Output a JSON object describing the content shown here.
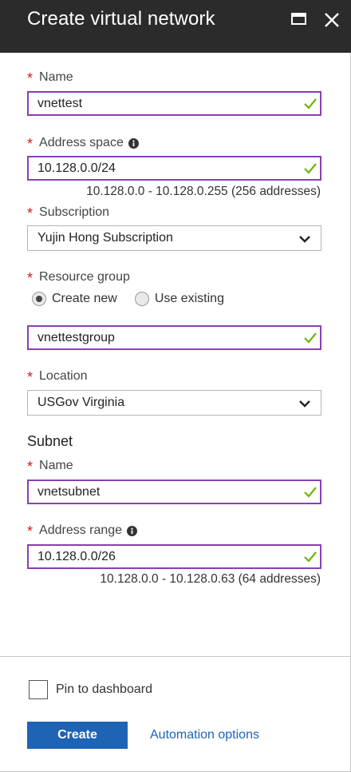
{
  "header": {
    "title": "Create virtual network"
  },
  "fields": {
    "name": {
      "label": "Name",
      "value": "vnettest"
    },
    "address_space": {
      "label": "Address space",
      "value": "10.128.0.0/24",
      "hint": "10.128.0.0 - 10.128.0.255 (256 addresses)"
    },
    "subscription": {
      "label": "Subscription",
      "value": "Yujin Hong Subscription"
    },
    "resource_group": {
      "label": "Resource group",
      "options": [
        "Create new",
        "Use existing"
      ],
      "selected": "Create new",
      "value": "vnettestgroup"
    },
    "location": {
      "label": "Location",
      "value": "USGov Virginia"
    }
  },
  "subnet": {
    "title": "Subnet",
    "name": {
      "label": "Name",
      "value": "vnetsubnet"
    },
    "address_range": {
      "label": "Address range",
      "value": "10.128.0.0/26",
      "hint": "10.128.0.0 - 10.128.0.63 (64 addresses)"
    }
  },
  "footer": {
    "pin_label": "Pin to dashboard",
    "create_label": "Create",
    "automation_label": "Automation options"
  },
  "colors": {
    "header_bg": "#2b2b2b",
    "required": "#c7201c",
    "input_border_valid": "#8a3fb0",
    "check": "#6bb700",
    "primary": "#1e63b4"
  }
}
